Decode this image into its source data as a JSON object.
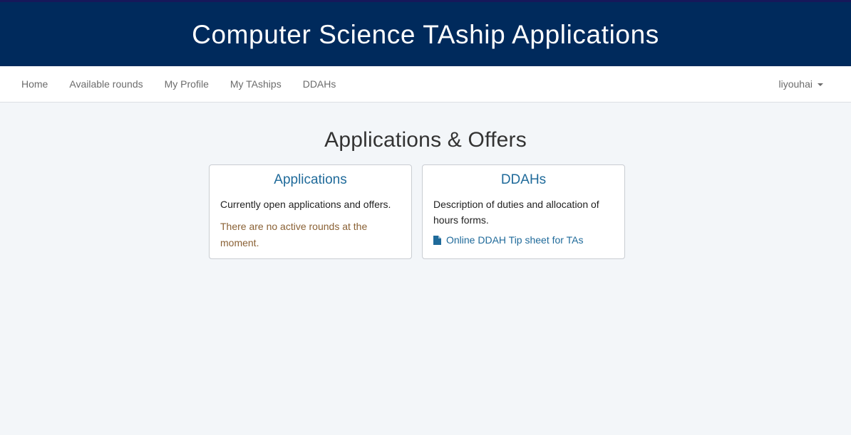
{
  "header": {
    "title": "Computer Science TAship Applications"
  },
  "nav": {
    "items": [
      {
        "label": "Home"
      },
      {
        "label": "Available rounds"
      },
      {
        "label": "My Profile"
      },
      {
        "label": "My TAships"
      },
      {
        "label": "DDAHs"
      }
    ],
    "user": "liyouhai"
  },
  "main": {
    "title": "Applications & Offers",
    "cards": [
      {
        "title": "Applications",
        "description": "Currently open applications and offers.",
        "notice": "There are no active rounds at the moment."
      },
      {
        "title": "DDAHs",
        "description": "Description of duties and allocation of hours forms.",
        "link": "Online DDAH Tip sheet for TAs",
        "link_icon": "file-icon"
      }
    ]
  },
  "colors": {
    "banner": "#002a5c",
    "link": "#1f6a9a",
    "warning_text": "#8a6135",
    "page_bg": "#f3f6f9"
  }
}
